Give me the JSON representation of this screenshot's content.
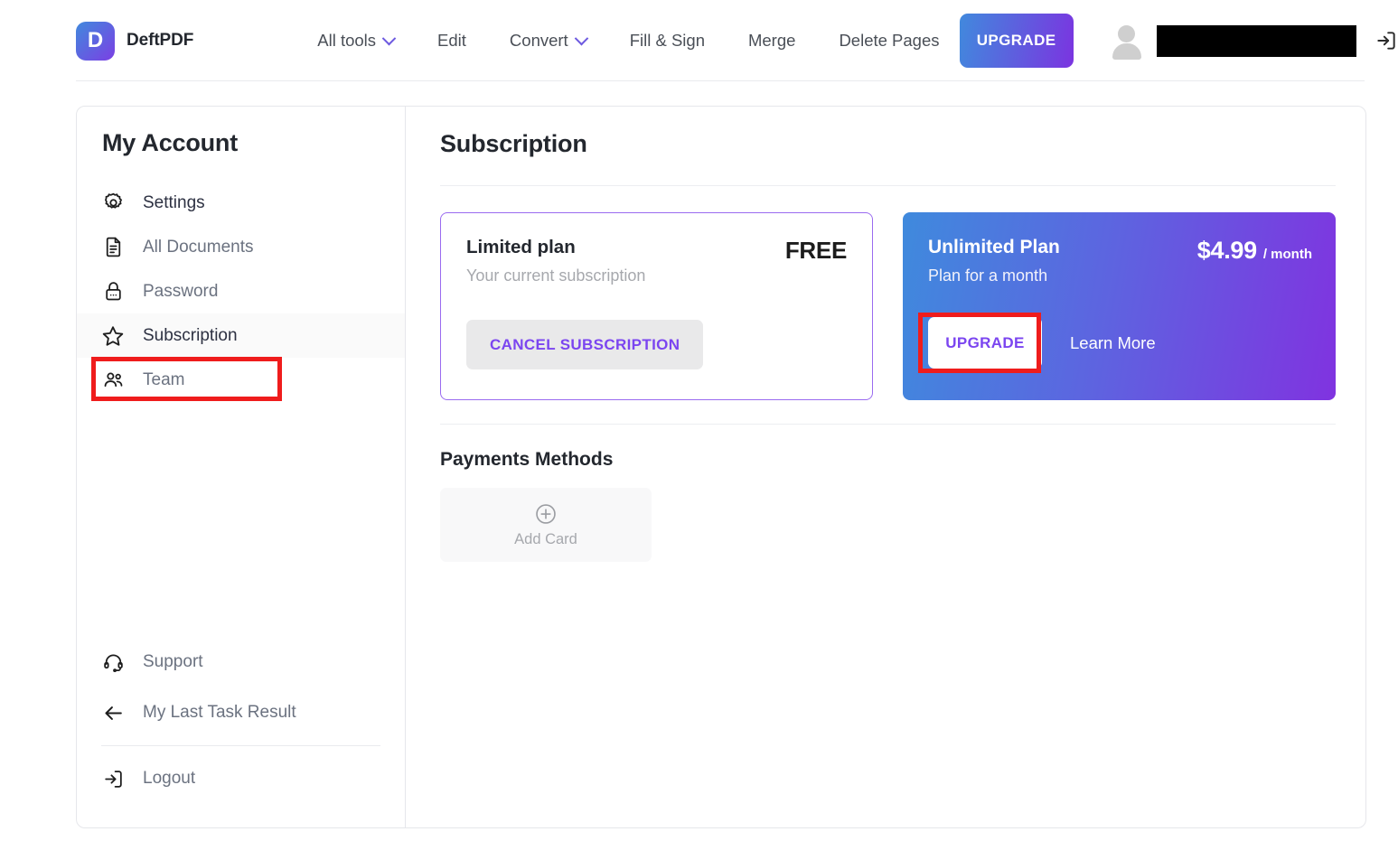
{
  "brand": {
    "logo_letter": "D",
    "name": "DeftPDF"
  },
  "nav": {
    "items": [
      {
        "label": "All tools",
        "has_dropdown": true
      },
      {
        "label": "Edit",
        "has_dropdown": false
      },
      {
        "label": "Convert",
        "has_dropdown": true
      },
      {
        "label": "Fill & Sign",
        "has_dropdown": false
      },
      {
        "label": "Merge",
        "has_dropdown": false
      },
      {
        "label": "Delete Pages",
        "has_dropdown": false
      }
    ],
    "upgrade_label": "UPGRADE",
    "account_name_redacted": "",
    "logout_icon": "logout-icon"
  },
  "sidebar": {
    "title": "My Account",
    "items": [
      {
        "label": "Settings",
        "icon": "gear-icon"
      },
      {
        "label": "All Documents",
        "icon": "document-icon"
      },
      {
        "label": "Password",
        "icon": "lock-icon"
      },
      {
        "label": "Subscription",
        "icon": "star-icon"
      },
      {
        "label": "Team",
        "icon": "users-icon"
      }
    ],
    "bottom_items": [
      {
        "label": "Support",
        "icon": "headset-icon"
      },
      {
        "label": "My Last Task Result",
        "icon": "arrow-left-icon"
      },
      {
        "label": "Logout",
        "icon": "logout-icon"
      }
    ]
  },
  "main": {
    "title": "Subscription",
    "free_plan": {
      "name": "Limited plan",
      "subtitle": "Your current subscription",
      "price": "FREE",
      "cancel_label": "CANCEL SUBSCRIPTION"
    },
    "pro_plan": {
      "name": "Unlimited Plan",
      "subtitle": "Plan for a month",
      "price_amount": "$4.99",
      "price_period": "/ month",
      "upgrade_label": "UPGRADE",
      "learn_more_label": "Learn More"
    },
    "payments": {
      "title": "Payments Methods",
      "add_card_label": "Add Card",
      "add_card_icon": "plus-circle-icon"
    }
  },
  "colors": {
    "accent_purple": "#7b45f0",
    "accent_blue": "#4189dd",
    "highlight_red": "#ef1c1c",
    "text_dark": "#23272e",
    "text_muted": "#6b7280"
  }
}
